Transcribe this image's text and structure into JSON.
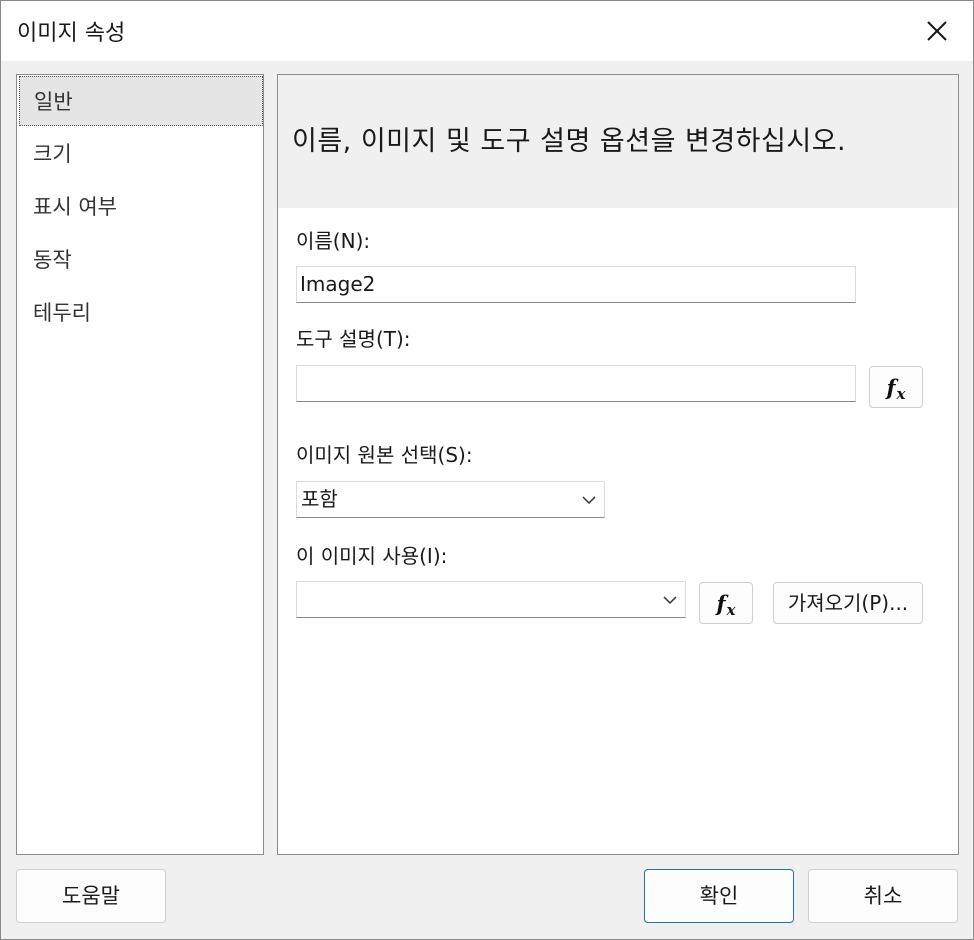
{
  "window": {
    "title": "이미지 속성"
  },
  "nav": {
    "items": [
      {
        "label": "일반",
        "selected": true
      },
      {
        "label": "크기",
        "selected": false
      },
      {
        "label": "표시 여부",
        "selected": false
      },
      {
        "label": "동작",
        "selected": false
      },
      {
        "label": "테두리",
        "selected": false
      }
    ]
  },
  "panel": {
    "header": "이름, 이미지 및 도구 설명 옵션을 변경하십시오.",
    "name_label": "이름(N):",
    "name_value": "Image2",
    "tooltip_label": "도구 설명(T):",
    "tooltip_value": "",
    "source_label": "이미지 원본 선택(S):",
    "source_value": "포함",
    "use_label": "이 이미지 사용(I):",
    "use_value": "",
    "fx_label": "f",
    "fx_sub": "x",
    "import_label": "가져오기(P)..."
  },
  "footer": {
    "help_label": "도움말",
    "ok_label": "확인",
    "cancel_label": "취소"
  }
}
